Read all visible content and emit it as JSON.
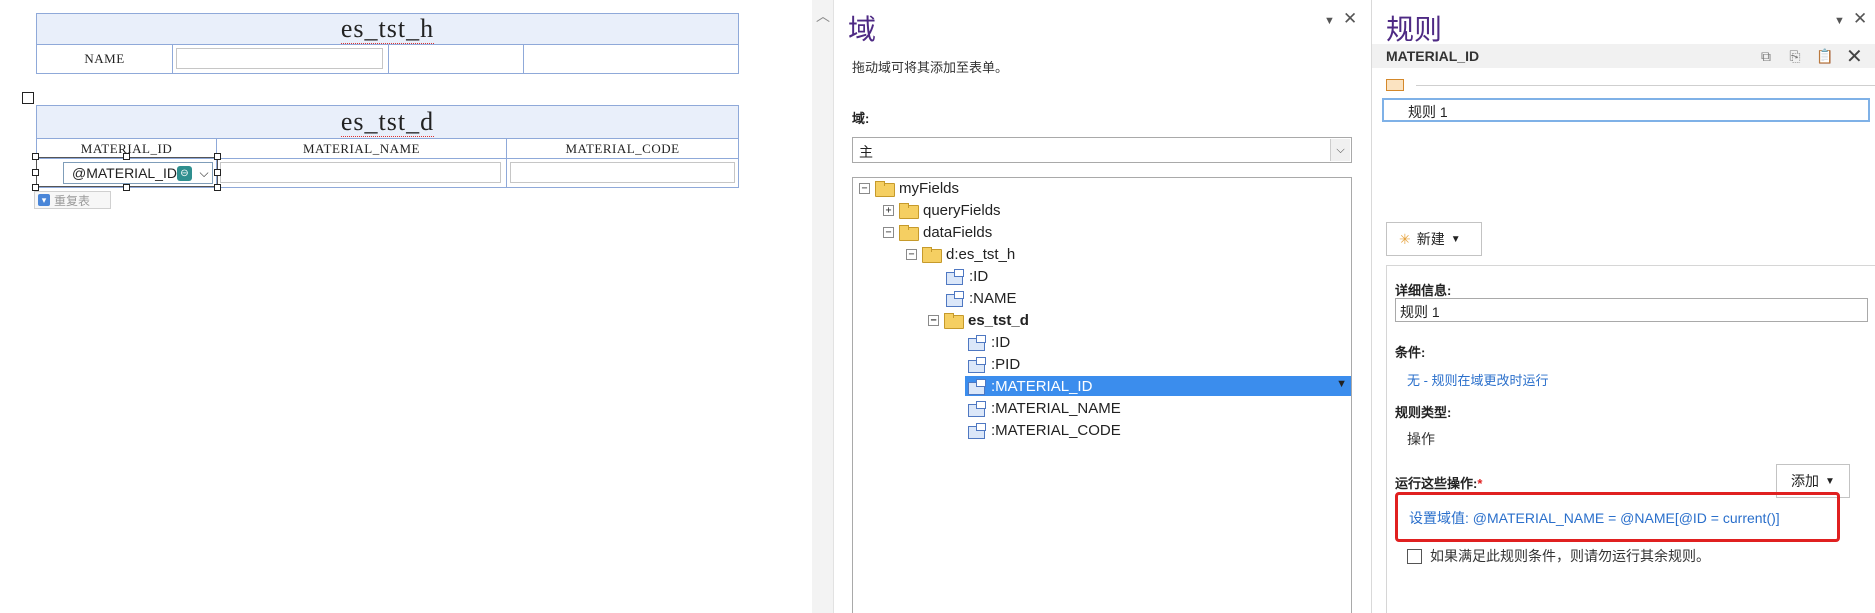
{
  "form": {
    "header_table": {
      "title": "es_tst_h",
      "name_label": "NAME"
    },
    "detail_table": {
      "title": "es_tst_d",
      "columns": [
        "MATERIAL_ID",
        "MATERIAL_NAME",
        "MATERIAL_CODE"
      ],
      "material_id_value": "@MATERIAL_ID",
      "repeat_button_label": "重复表"
    }
  },
  "fields_panel": {
    "title": "域",
    "hint": "拖动域可将其添加至表单。",
    "fields_label": "域:",
    "datasource_value": "主",
    "tree": [
      {
        "label": "myFields",
        "kind": "folder",
        "expander": "⊟"
      },
      {
        "label": "queryFields",
        "kind": "folder",
        "expander": "⊞"
      },
      {
        "label": "dataFields",
        "kind": "folder",
        "expander": "⊟"
      },
      {
        "label": "d:es_tst_h",
        "kind": "folder",
        "expander": "⊟"
      },
      {
        "label": ":ID",
        "kind": "field"
      },
      {
        "label": ":NAME",
        "kind": "field"
      },
      {
        "label": "es_tst_d",
        "kind": "folder",
        "expander": "⊟"
      },
      {
        "label": ":ID",
        "kind": "field"
      },
      {
        "label": ":PID",
        "kind": "field"
      },
      {
        "label": ":MATERIAL_ID",
        "kind": "field",
        "selected": true
      },
      {
        "label": ":MATERIAL_NAME",
        "kind": "field"
      },
      {
        "label": ":MATERIAL_CODE",
        "kind": "field"
      }
    ]
  },
  "rules_panel": {
    "title": "规则",
    "field_name": "MATERIAL_ID",
    "rule_item": "规则 1",
    "new_button": "新建",
    "details_label": "详细信息:",
    "rule_name_value": "规则 1",
    "condition_label": "条件:",
    "condition_value": "无 - 规则在域更改时运行",
    "rule_type_label": "规则类型:",
    "rule_type_value": "操作",
    "actions_label": "运行这些操作:",
    "required_mark": "*",
    "add_button": "添加",
    "action_text": "设置域值: @MATERIAL_NAME = @NAME[@ID = current()]",
    "stop_rules_text": "如果满足此规则条件，则请勿运行其余规则。"
  },
  "colors": {
    "panel_title": "#4e2a84",
    "selection": "#3b8ded",
    "link": "#2a6fcb",
    "highlight_box": "#e02020",
    "table_border": "#8fa9d9",
    "table_header_bg": "#e9effa"
  }
}
